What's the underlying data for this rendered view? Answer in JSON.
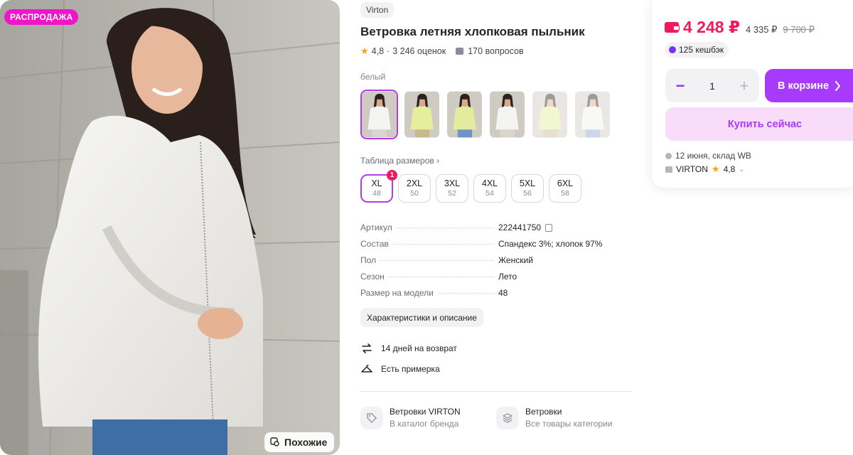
{
  "photo": {
    "sale_badge": "РАСПРОДАЖА",
    "similar_label": "Похожие"
  },
  "product": {
    "brand": "Virton",
    "title": "Ветровка летняя хлопковая пыльник",
    "rating": "4,8",
    "reviews": "3 246 оценок",
    "questions": "170 вопросов",
    "color_label": "белый",
    "thumbs": [
      {
        "color": "white"
      },
      {
        "color": "lime"
      },
      {
        "color": "lime-blue"
      },
      {
        "color": "white"
      },
      {
        "color": "lime"
      },
      {
        "color": "white-blue"
      }
    ],
    "size_table_label": "Таблица размеров ›",
    "sizes": [
      {
        "label": "XL",
        "sub": "48",
        "badge": "1"
      },
      {
        "label": "2XL",
        "sub": "50"
      },
      {
        "label": "3XL",
        "sub": "52"
      },
      {
        "label": "4XL",
        "sub": "54"
      },
      {
        "label": "5XL",
        "sub": "56"
      },
      {
        "label": "6XL",
        "sub": "58"
      }
    ],
    "specs": [
      {
        "key": "Артикул",
        "value": "222441750"
      },
      {
        "key": "Состав",
        "value": "Спандекс 3%; хлопок 97%"
      },
      {
        "key": "Пол",
        "value": "Женский"
      },
      {
        "key": "Сезон",
        "value": "Лето"
      },
      {
        "key": "Размер на модели",
        "value": "48"
      }
    ],
    "chars_button": "Характеристики и описание",
    "features": [
      "14 дней на возврат",
      "Есть примерка"
    ],
    "categories": [
      {
        "title": "Ветровки VIRTON",
        "subtitle": "В каталог бренда"
      },
      {
        "title": "Ветровки",
        "subtitle": "Все товары категории"
      }
    ]
  },
  "buy_card": {
    "price": "4 248 ₽",
    "price_without_wallet": "4 335 ₽",
    "price_old": "9 700 ₽",
    "cashback": "125 кешбэк",
    "quantity": "1",
    "cart_label": "В корзине",
    "buy_now_label": "Купить сейчас",
    "delivery": "12 июня, склад WB",
    "seller_name": "VIRTON",
    "seller_rating": "4,8"
  },
  "colors": {
    "accent": "#a73afd",
    "price": "#f0195a",
    "sale": "#f016c8"
  }
}
